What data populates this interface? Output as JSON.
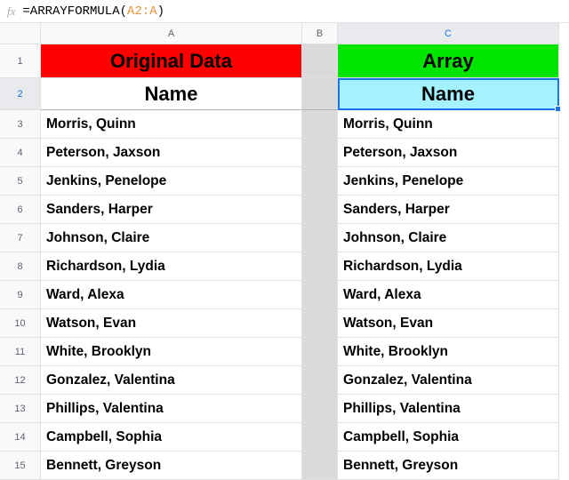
{
  "formula": {
    "eq": "=",
    "fn": "ARRAYFORMULA",
    "open": "(",
    "ref": "A2:A",
    "close": ")"
  },
  "columns": {
    "a": "A",
    "b": "B",
    "c": "C"
  },
  "header1": {
    "original": "Original Data",
    "array": "Array"
  },
  "header2": {
    "nameA": "Name",
    "nameC": "Name"
  },
  "rows": [
    {
      "n": "3",
      "a": "Morris, Quinn",
      "c": "Morris, Quinn"
    },
    {
      "n": "4",
      "a": "Peterson, Jaxson",
      "c": "Peterson, Jaxson"
    },
    {
      "n": "5",
      "a": "Jenkins, Penelope",
      "c": "Jenkins, Penelope"
    },
    {
      "n": "6",
      "a": "Sanders, Harper",
      "c": "Sanders, Harper"
    },
    {
      "n": "7",
      "a": "Johnson, Claire",
      "c": "Johnson, Claire"
    },
    {
      "n": "8",
      "a": "Richardson, Lydia",
      "c": "Richardson, Lydia"
    },
    {
      "n": "9",
      "a": "Ward, Alexa",
      "c": "Ward, Alexa"
    },
    {
      "n": "10",
      "a": "Watson, Evan",
      "c": "Watson, Evan"
    },
    {
      "n": "11",
      "a": "White, Brooklyn",
      "c": "White, Brooklyn"
    },
    {
      "n": "12",
      "a": "Gonzalez, Valentina",
      "c": "Gonzalez, Valentina"
    },
    {
      "n": "13",
      "a": "Phillips, Valentina",
      "c": "Phillips, Valentina"
    },
    {
      "n": "14",
      "a": "Campbell, Sophia",
      "c": "Campbell, Sophia"
    },
    {
      "n": "15",
      "a": "Bennett, Greyson",
      "c": "Bennett, Greyson"
    }
  ],
  "rowNums": {
    "r1": "1",
    "r2": "2"
  }
}
